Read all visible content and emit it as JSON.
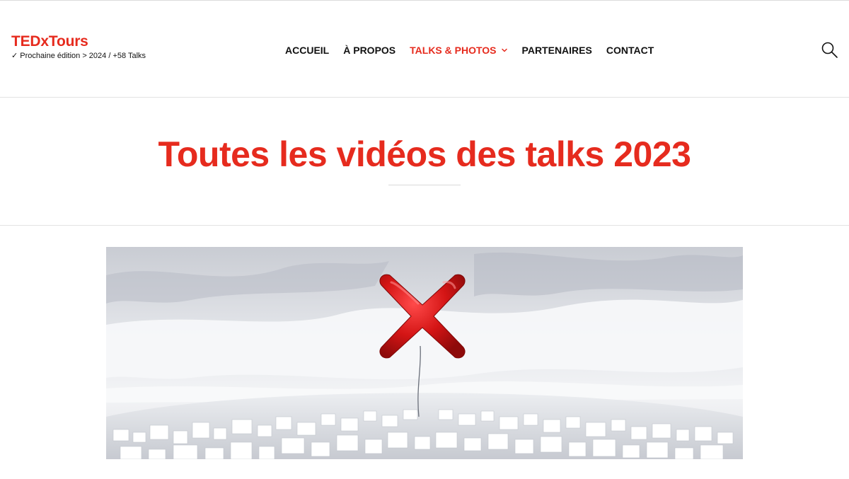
{
  "brand": {
    "name": "TEDxTours",
    "tagline": "✓ Prochaine édition > 2024 / +58 Talks",
    "color": "#e62b1e"
  },
  "nav": {
    "items": [
      {
        "label": "ACCUEIL"
      },
      {
        "label": "À PROPOS"
      },
      {
        "label": "TALKS & PHOTOS",
        "active": true,
        "icon": "chevron-down-icon"
      },
      {
        "label": "PARTENAIRES"
      },
      {
        "label": "CONTACT"
      }
    ],
    "search_icon": "search-icon"
  },
  "hero": {
    "title": "Toutes les vidéos des talks 2023"
  },
  "banner": {
    "description_icon": "red-x-balloon-over-city"
  }
}
